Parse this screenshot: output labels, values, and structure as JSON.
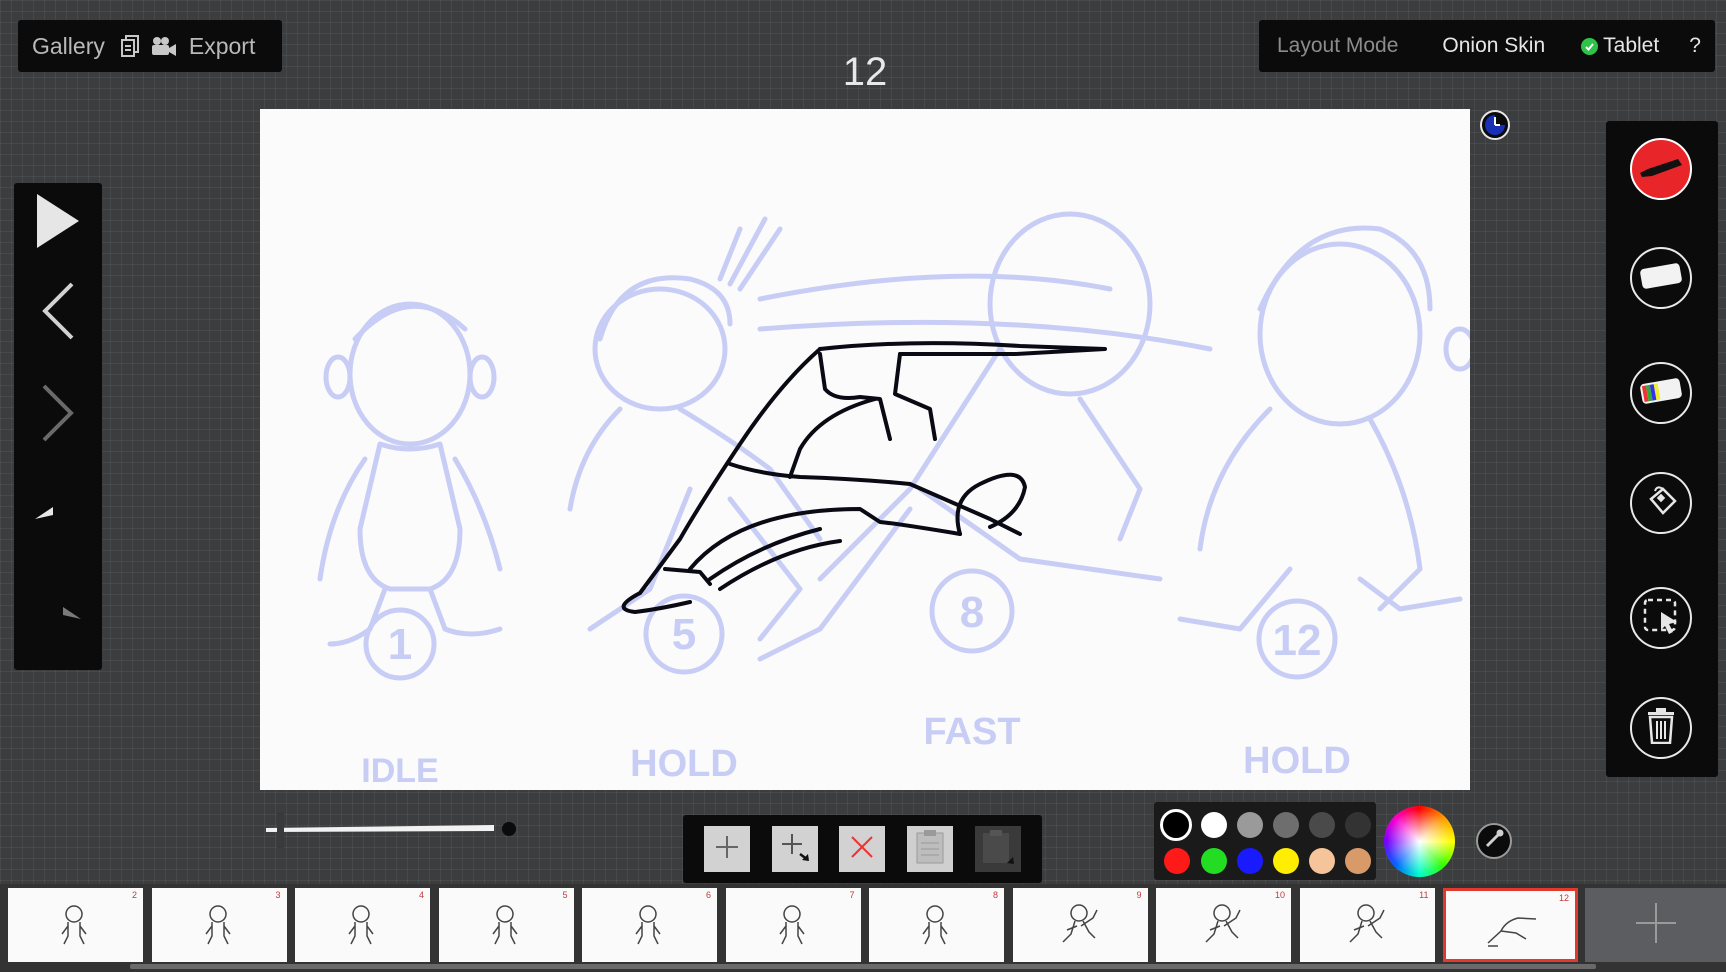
{
  "top_left_bar": {
    "gallery_label": "Gallery",
    "export_label": "Export",
    "icons": [
      "clipboard-copy-icon",
      "camera-icon"
    ]
  },
  "frame_number": "12",
  "top_right_bar": {
    "layout_mode_label": "Layout Mode",
    "onion_skin_label": "Onion Skin",
    "tablet_label": "Tablet",
    "tablet_enabled": true,
    "help_label": "?"
  },
  "canvas": {
    "annotations": [
      {
        "number": "1",
        "caption": "IDLE"
      },
      {
        "number": "5",
        "caption": "HOLD"
      },
      {
        "number": "8",
        "caption": "FAST"
      },
      {
        "number": "12",
        "caption": "HOLD"
      }
    ],
    "onion_color": "#c8cdf5",
    "ink_color": "#0a0a14"
  },
  "playback_controls": [
    "play-icon",
    "previous-frame-icon",
    "next-frame-icon",
    "undo-icon",
    "redo-icon"
  ],
  "tools": [
    {
      "name": "pen",
      "icon": "marker-icon",
      "active": true
    },
    {
      "name": "eraser",
      "icon": "eraser-icon",
      "active": false
    },
    {
      "name": "color-eraser",
      "icon": "color-eraser-icon",
      "active": false
    },
    {
      "name": "fill",
      "icon": "paint-bucket-icon",
      "active": false
    },
    {
      "name": "select",
      "icon": "lasso-select-icon",
      "active": false
    },
    {
      "name": "clear",
      "icon": "trash-icon",
      "active": false
    }
  ],
  "brush_size_fraction": 0.05,
  "frame_actions": [
    "add-frame-icon",
    "insert-frame-icon",
    "delete-frame-icon",
    "paste-frame-icon",
    "paste-after-icon"
  ],
  "palette": {
    "selected_color": "#000000",
    "colors": [
      "#000000",
      "#ffffff",
      "#9a9a9a",
      "#6e6e6e",
      "#4a4a4a",
      "#333333",
      "#ff1a1a",
      "#22dd22",
      "#1a1aff",
      "#ffee00",
      "#f5c49a",
      "#d99a6a"
    ]
  },
  "filmstrip": {
    "frames": [
      "2",
      "3",
      "4",
      "5",
      "6",
      "7",
      "8",
      "9",
      "10",
      "11",
      "12"
    ],
    "current_frame": "12"
  }
}
